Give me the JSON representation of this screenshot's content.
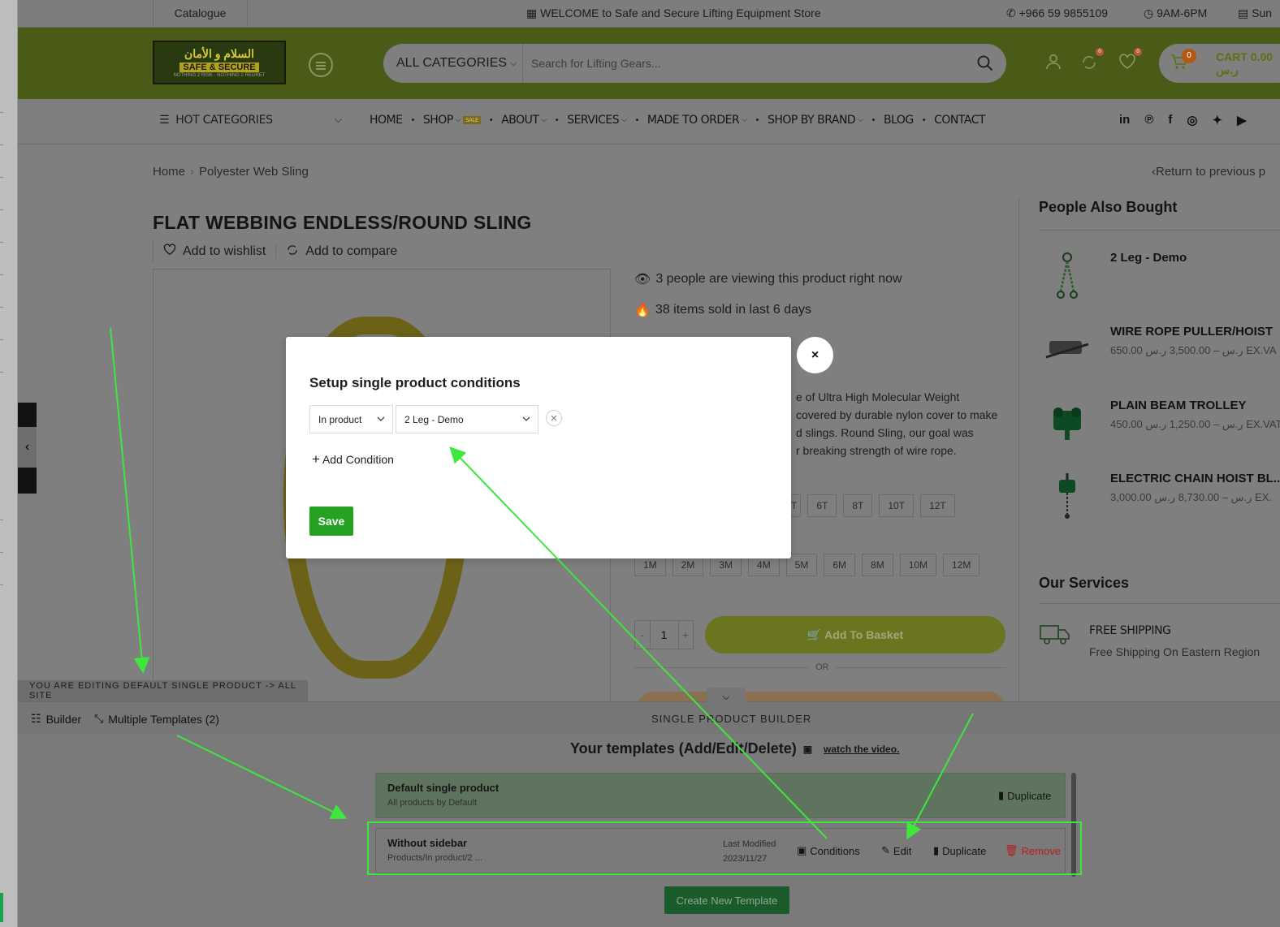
{
  "topbar": {
    "catalogue": "Catalogue",
    "welcome": "WELCOME to Safe and Secure Lifting Equipment Store",
    "phone": "+966 59 9855109",
    "hours": "9AM-6PM",
    "day": "Sun"
  },
  "header": {
    "logo_arabic": "السلام و الأمان",
    "logo_english": "SAFE & SECURE",
    "logo_tagline": "NOTHING 2 RISK · NOTHING 2 REGRET",
    "search_category": "ALL CATEGORIES",
    "search_placeholder": "Search for Lifting Gears...",
    "compare_count": "0",
    "wishlist_count": "0",
    "cart_count": "0",
    "cart_label": "CART 0.00 ر.س"
  },
  "nav": {
    "hot_categories": "HOT CATEGORIES",
    "items": [
      "HOME",
      "SHOP",
      "ABOUT",
      "SERVICES",
      "MADE TO ORDER",
      "SHOP BY BRAND",
      "BLOG",
      "CONTACT"
    ],
    "sale_badge": "SALE"
  },
  "breadcrumb": {
    "home": "Home",
    "current": "Polyester Web Sling",
    "return": "Return to previous p"
  },
  "product": {
    "title": "FLAT WEBBING ENDLESS/ROUND SLING",
    "wishlist": "Add to wishlist",
    "compare": "Add to compare",
    "viewing": "3 people are viewing this product right now",
    "sold": "38 items sold in last 6 days",
    "desc_lines": [
      "e of Ultra High Molecular Weight",
      "covered by durable nylon cover to make",
      "d slings. Round Sling, our goal was",
      "r breaking strength of wire rope."
    ],
    "capacity_options": [
      "T",
      "6T",
      "8T",
      "10T",
      "12T"
    ],
    "length_options": [
      "1M",
      "2M",
      "3M",
      "4M",
      "5M",
      "6M",
      "8M",
      "10M",
      "12M"
    ],
    "quantity": "1",
    "add_to_basket": "Add To Basket",
    "or": "OR"
  },
  "sidebar": {
    "people_also_bought": "People Also Bought",
    "products": [
      {
        "name": "2 Leg - Demo",
        "price": ""
      },
      {
        "name": "WIRE ROPE PULLER/HOIST",
        "price": "650.00 ر.س – 3,500.00 ر.س EX.VA"
      },
      {
        "name": "PLAIN BEAM TROLLEY",
        "price": "450.00 ر.س – 1,250.00 ر.س EX.VAT"
      },
      {
        "name": "ELECTRIC CHAIN HOIST BL...",
        "price": "3,000.00 ر.س – 8,730.00 ر.س EX."
      }
    ],
    "our_services": "Our Services",
    "service_title": "FREE SHIPPING",
    "service_desc": "Free Shipping On Eastern Region"
  },
  "editor": {
    "editing_label": "YOU ARE EDITING DEFAULT SINGLE PRODUCT -> ALL SITE",
    "builder_tab": "Builder",
    "multiple_tab": "Multiple Templates (2)",
    "center_title": "SINGLE PRODUCT BUILDER",
    "templates_title": "Your templates (Add/Edit/Delete)",
    "watch_video": "watch the video.",
    "templates": [
      {
        "name": "Default single product",
        "sub": "All products by Default",
        "duplicate": "Duplicate"
      },
      {
        "name": "Without sidebar",
        "sub": "Products/In product/2 ...",
        "last_modified_label": "Last Modified",
        "last_modified_date": "2023/11/27",
        "conditions": "Conditions",
        "edit": "Edit",
        "duplicate": "Duplicate",
        "remove": "Remove"
      }
    ],
    "create_new": "Create New Template"
  },
  "modal": {
    "title": "Setup single product conditions",
    "condition_type": "In product",
    "condition_value": "2 Leg - Demo",
    "add_condition": "Add Condition",
    "save": "Save",
    "close": "×"
  },
  "colors": {
    "annotation_green": "#3ee63e",
    "save_green": "#25a224",
    "remove_red": "#d32f2f"
  }
}
